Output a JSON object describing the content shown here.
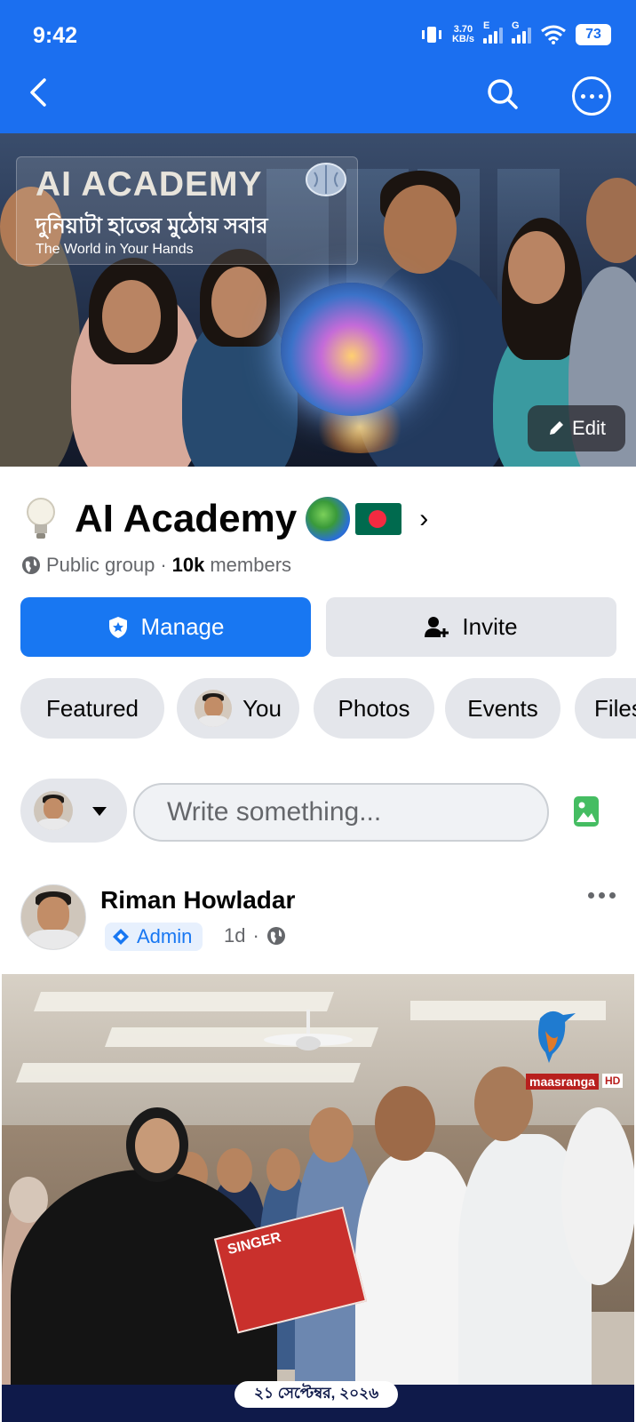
{
  "status_bar": {
    "time": "9:42",
    "net_speed_value": "3.70",
    "net_speed_unit": "KB/s",
    "signal1_type": "E",
    "signal2_type": "G",
    "battery": "73"
  },
  "top_nav": {
    "back_icon": "back-arrow-icon",
    "search_icon": "search-icon",
    "more_icon": "more-options-icon",
    "bar_color": "#1b6ff0"
  },
  "cover": {
    "title": "AI ACADEMY",
    "subtitle_bn": "দুনিয়াটা হাতের মুঠোয় সবার",
    "subtitle_en": "The World in Your Hands",
    "edit_label": "Edit"
  },
  "group": {
    "name": "AI Academy",
    "privacy": "Public group",
    "members_count": "10k",
    "members_label": "members",
    "separator": "·"
  },
  "actions": {
    "manage_label": "Manage",
    "invite_label": "Invite",
    "primary_color": "#1877f2"
  },
  "chips": [
    {
      "label": "Featured"
    },
    {
      "label": "You"
    },
    {
      "label": "Photos"
    },
    {
      "label": "Events"
    },
    {
      "label": "Files"
    }
  ],
  "composer": {
    "placeholder": "Write something..."
  },
  "post": {
    "author": "Riman Howladar",
    "role": "Admin",
    "time": "1d",
    "separator": "·",
    "watermark_text": "maasranga",
    "watermark_hd": "HD",
    "gift_text": "SINGER",
    "date_caption": "২১ সেপ্টেম্বর, ২০২৬"
  }
}
